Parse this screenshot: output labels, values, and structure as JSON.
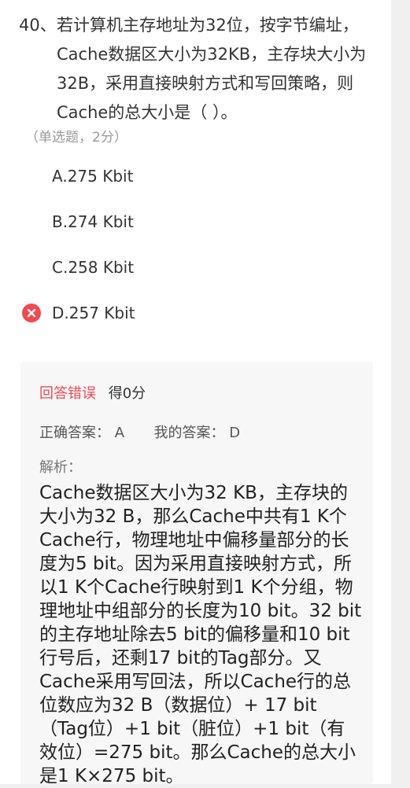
{
  "question": {
    "number": "40、",
    "text": "若计算机主存地址为32位，按字节编址，Cache数据区大小为32KB，主存块大小为32B，采用直接映射方式和写回策略，则Cache的总大小是（ ）。",
    "meta": "（单选题，2分）"
  },
  "options": [
    {
      "label": "A.275 Kbit",
      "selected_wrong": false
    },
    {
      "label": "B.274 Kbit",
      "selected_wrong": false
    },
    {
      "label": "C.258 Kbit",
      "selected_wrong": false
    },
    {
      "label": "D.257 Kbit",
      "selected_wrong": true
    }
  ],
  "analysis": {
    "result_label": "回答错误",
    "score_label": "得0分",
    "correct_answer_label": "正确答案：",
    "correct_answer": "A",
    "my_answer_label": "我的答案：",
    "my_answer": "D",
    "explanation_label": "解析：",
    "explanation": "Cache数据区大小为32 KB，主存块的大小为32 B，那么Cache中共有1 K个Cache行，物理地址中偏移量部分的长度为5 bit。因为采用直接映射方式，所以1 K个Cache行映射到1 K个分组，物理地址中组部分的长度为10 bit。32 bit的主存地址除去5 bit的偏移量和10 bit行号后，还剩17 bit的Tag部分。又Cache采用写回法，所以Cache行的总位数应为32 B（数据位）+ 17 bit（Tag位）+1 bit（脏位）+1 bit（有效位）=275 bit。那么Cache的总大小是1 K×275 bit。"
  },
  "colors": {
    "wrong": "#f2484f",
    "background": "#f0f0f0",
    "card": "#ffffff",
    "analysis_bg": "#f7f7f7"
  }
}
